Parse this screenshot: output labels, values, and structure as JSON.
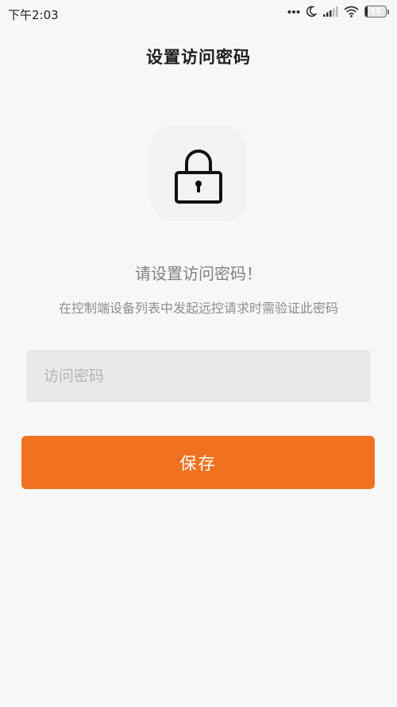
{
  "status_bar": {
    "time": "下午2:03",
    "battery_level": "11",
    "battery_fraction": 0.11,
    "icons": [
      "dots-icon",
      "moon-icon",
      "signal-icon",
      "wifi-icon",
      "battery-icon"
    ]
  },
  "header": {
    "title": "设置访问密码"
  },
  "lock": {
    "icon": "lock-icon"
  },
  "content": {
    "heading": "请设置访问密码！",
    "description": "在控制端设备列表中发起远控请求时需验证此密码"
  },
  "form": {
    "password_placeholder": "访问密码",
    "password_value": "",
    "save_label": "保存"
  },
  "colors": {
    "accent": "#f07220",
    "background": "#f7f7f7",
    "input_bg": "#e9e9e9"
  }
}
